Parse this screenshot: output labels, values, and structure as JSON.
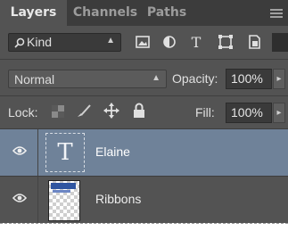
{
  "tabs": [
    {
      "label": "Layers",
      "active": true
    },
    {
      "label": "Channels",
      "active": false
    },
    {
      "label": "Paths",
      "active": false
    }
  ],
  "filter": {
    "kind_label": "Kind",
    "icons": [
      "pixel-filter-icon",
      "adjustment-filter-icon",
      "type-filter-icon",
      "shape-filter-icon",
      "smart-object-filter-icon"
    ]
  },
  "blend": {
    "mode": "Normal",
    "opacity_label": "Opacity:",
    "opacity_value": "100%"
  },
  "lock": {
    "label": "Lock:",
    "fill_label": "Fill:",
    "fill_value": "100%"
  },
  "layers": [
    {
      "name": "Elaine",
      "type": "text",
      "selected": true,
      "visible": true
    },
    {
      "name": "Ribbons",
      "type": "image",
      "selected": false,
      "visible": true
    }
  ],
  "colors": {
    "panel_bg": "#535353",
    "tabbar_bg": "#3c3c3c",
    "selected_row": "#6f8299"
  }
}
